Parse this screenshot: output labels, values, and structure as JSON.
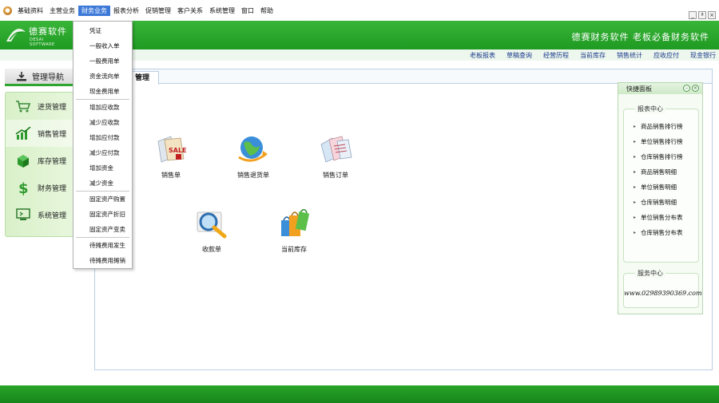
{
  "menubar": {
    "items": [
      "基础资料",
      "主营业务",
      "财务业务",
      "报表分析",
      "促销管理",
      "客户关系",
      "系统管理",
      "窗口",
      "帮助"
    ],
    "active_index": 2,
    "window_controls": [
      "_",
      "ª",
      "×"
    ]
  },
  "banner": {
    "logo_cn": "德赛软件",
    "logo_en": "DESAI SOFTWARE",
    "slogan": "德赛财务软件  老板必备财务软件"
  },
  "quicklinks": [
    "老板报表",
    "草稿查询",
    "经营历程",
    "当前库存",
    "销售统计",
    "应收应付",
    "现金银行"
  ],
  "nav": {
    "header": "管理导航",
    "items": [
      {
        "label": "进货管理",
        "icon": "cart-icon"
      },
      {
        "label": "销售管理",
        "icon": "chart-up-icon"
      },
      {
        "label": "库存管理",
        "icon": "box-icon"
      },
      {
        "label": "财务管理",
        "icon": "dollar-icon"
      },
      {
        "label": "系统管理",
        "icon": "monitor-icon"
      }
    ],
    "selected_index": 1
  },
  "main": {
    "tab_label": "管理",
    "functions": [
      {
        "label": "销售单",
        "icon": "sale-tag-icon"
      },
      {
        "label": "销售退货单",
        "icon": "globe-return-icon"
      },
      {
        "label": "销售订单",
        "icon": "order-tags-icon"
      },
      {
        "label": "收款单",
        "icon": "magnifier-icon"
      },
      {
        "label": "当前库存",
        "icon": "shopping-bags-icon"
      }
    ]
  },
  "quick_panel": {
    "title": "快捷面板",
    "report_center": {
      "title": "报表中心",
      "links": [
        "商品销售排行榜",
        "单位销售排行榜",
        "仓库销售排行榜",
        "商品销售明细",
        "单位销售明细",
        "仓库销售明细",
        "单位销售分布表",
        "仓库销售分布表"
      ]
    },
    "service_center": {
      "title": "服务中心",
      "url": "www.02989390369.com"
    }
  },
  "dropdown": {
    "groups": [
      [
        "凭证",
        "一般收入单",
        "一般费用单",
        "资金流向单",
        "现金费用单"
      ],
      [
        "增加应收款",
        "减少应收款",
        "增加应付款",
        "减少应付款",
        "增加资金",
        "减少资金"
      ],
      [
        "固定资产购置",
        "固定资产折旧",
        "固定资产变卖"
      ],
      [
        "待摊费用发生",
        "待摊费用摊销"
      ]
    ]
  },
  "colors": {
    "brand_green": "#1f9a22",
    "menu_highlight": "#3c78d8",
    "link_blue": "#1a3a8a"
  }
}
